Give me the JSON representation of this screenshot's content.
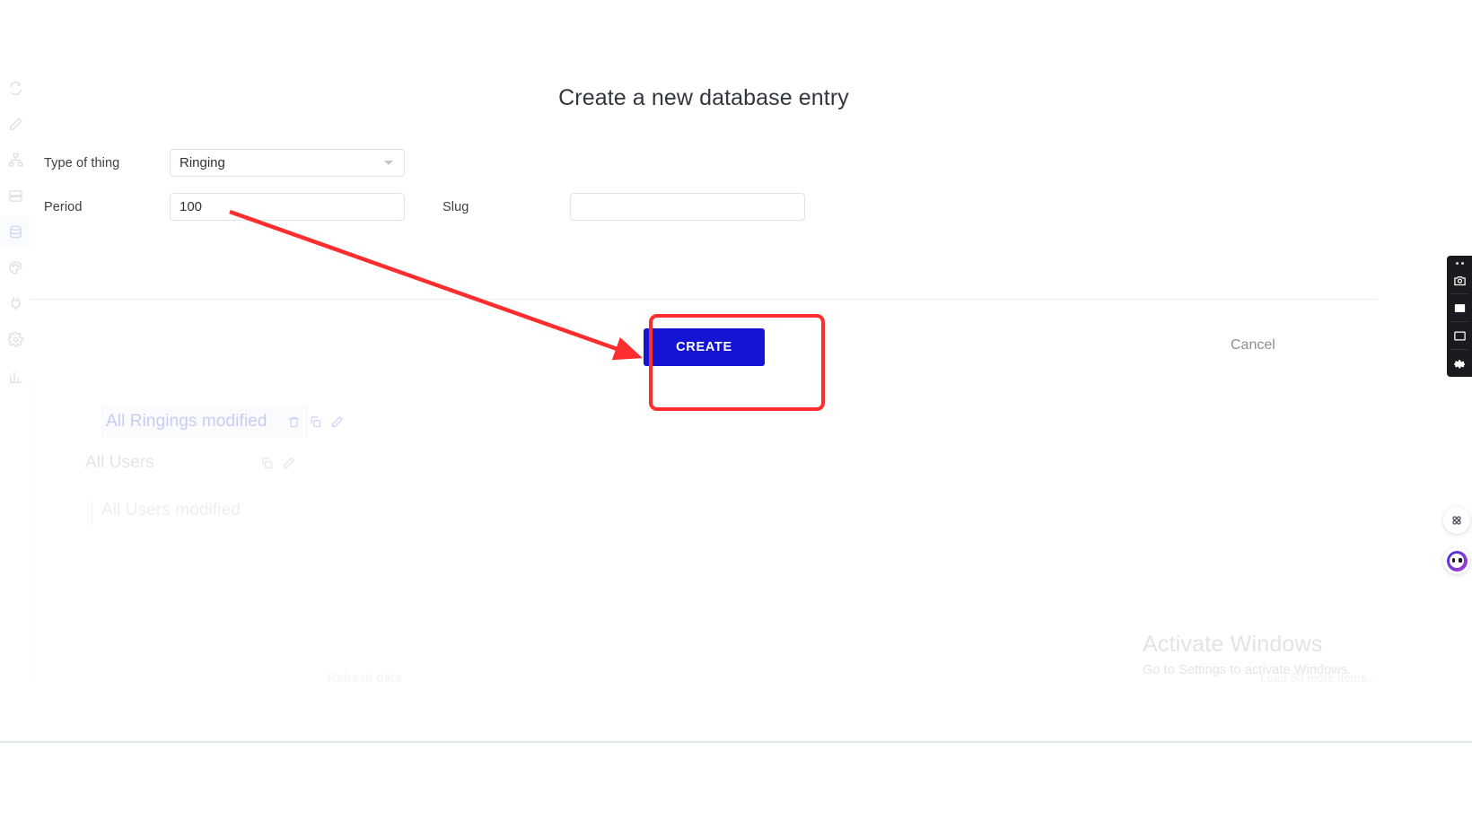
{
  "modal": {
    "title": "Create a new database entry",
    "fields": [
      {
        "label": "Type of thing",
        "type": "select",
        "value": "Ringing"
      },
      {
        "label": "Period",
        "type": "text",
        "value": "100"
      },
      {
        "label": "Slug",
        "type": "text",
        "value": "",
        "placeholder": ""
      }
    ],
    "create_label": "CREATE",
    "cancel_label": "Cancel"
  },
  "background": {
    "rows": [
      {
        "label": "All Ringings modified",
        "icons": [
          "trash-icon",
          "copy-icon",
          "pencil-icon"
        ]
      },
      {
        "label": "All Users",
        "icons": [
          "copy-icon",
          "pencil-icon"
        ]
      },
      {
        "label": "All Users modified",
        "icons": []
      }
    ],
    "refresh_label": "Refresh data",
    "load_more_label": "Load 50 more items..."
  },
  "sidebar": {
    "items": [
      {
        "name": "loop-icon"
      },
      {
        "name": "pencil-icon"
      },
      {
        "name": "workflow-icon"
      },
      {
        "name": "layers-icon"
      },
      {
        "name": "database-icon",
        "active": true
      },
      {
        "name": "palette-icon"
      },
      {
        "name": "plug-icon"
      },
      {
        "name": "gear-icon"
      },
      {
        "name": "chart-icon"
      }
    ]
  },
  "recorder": {
    "buttons": [
      "camera-icon",
      "stop-icon",
      "window-icon",
      "gear-icon"
    ]
  },
  "widgets": {
    "apps": "grid-apps-icon",
    "assistant": "assistant-face-icon"
  },
  "watermark": {
    "title": "Activate Windows",
    "subtitle": "Go to Settings to activate Windows."
  },
  "colors": {
    "create_button": "#1414d2",
    "annotation": "#ff2d2d",
    "active_sidebar": "#6b7fe8"
  }
}
